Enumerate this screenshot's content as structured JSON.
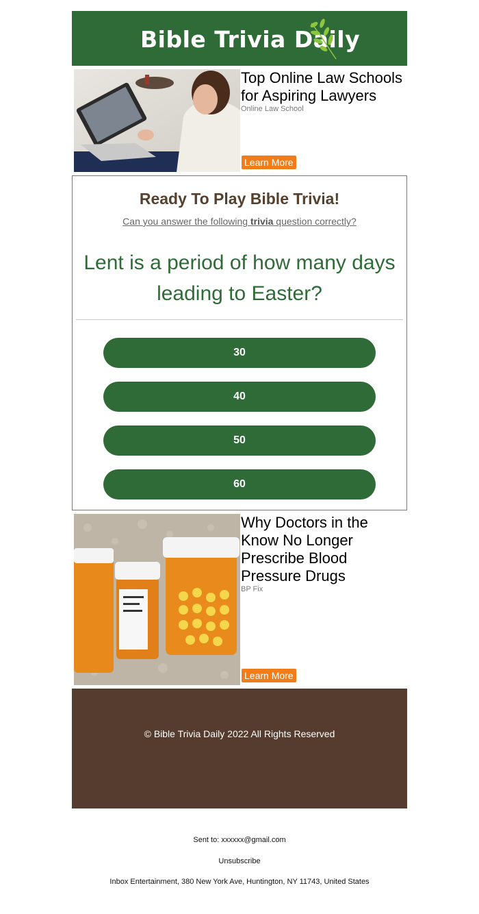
{
  "header": {
    "logo_text": "Bible Trivia Daily",
    "background_color": "#2e6b36",
    "leaf_icon": "leaf-branch-icon"
  },
  "ads": [
    {
      "title": "Top Online Law Schools for Aspiring Lawyers",
      "source": "Online Law School",
      "button_label": "Learn More",
      "image": "woman-with-laptop-photo"
    },
    {
      "title": "Why Doctors in the Know No Longer Prescribe Blood Pressure Drugs",
      "source": "BP Fix",
      "button_label": "Learn More",
      "image": "pill-bottles-photo"
    }
  ],
  "trivia": {
    "heading": "Ready To Play Bible Trivia!",
    "sub_before": "Can you answer the following ",
    "sub_bold": "trivia",
    "sub_after": " question correctly?",
    "question": "Lent is a period of how many days leading to Easter?",
    "answers": [
      "30",
      "40",
      "50",
      "60"
    ],
    "accent_color": "#2e6b36",
    "heading_color": "#56402e"
  },
  "footer": {
    "copyright": "© Bible Trivia Daily 2022 All Rights Reserved",
    "background_color": "#553c2e"
  },
  "meta": {
    "sent_to": "Sent to: xxxxxx@gmail.com",
    "unsubscribe": "Unsubscribe",
    "address": "Inbox Entertainment, 380 New York Ave, Huntington, NY 11743, United States"
  },
  "colors": {
    "button_orange": "#f07d1a"
  }
}
